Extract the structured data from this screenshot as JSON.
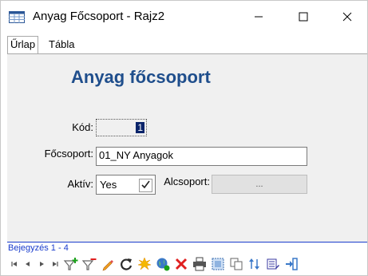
{
  "window": {
    "title": "Anyag Főcsoport - Rajz2",
    "minimize_icon": "minimize-icon",
    "maximize_icon": "maximize-icon",
    "close_icon": "close-icon"
  },
  "tabs": [
    {
      "label": "Űrlap",
      "active": true
    },
    {
      "label": "Tábla",
      "active": false
    }
  ],
  "form": {
    "title": "Anyag főcsoport",
    "kod_label": "Kód:",
    "kod_value": "1",
    "focsoport_label": "Főcsoport:",
    "focsoport_value": "01_NY Anyagok",
    "aktiv_label": "Aktív:",
    "aktiv_value": "Yes",
    "aktiv_checked": true,
    "alcsoport_label": "Alcsoport:",
    "alcsoport_button_label": "..."
  },
  "status": {
    "record_text": "Bejegyzés 1 - 4"
  },
  "navigation": {
    "icons": [
      "first-record-icon",
      "previous-record-icon",
      "next-record-icon",
      "last-record-icon",
      "add-filter-icon",
      "remove-filter-icon",
      "edit-pencil-icon",
      "refresh-icon",
      "new-record-icon",
      "web-export-icon",
      "delete-icon",
      "print-icon",
      "select-icon",
      "copy-icon",
      "sort-icon",
      "list-edit-icon",
      "exit-icon"
    ],
    "colors": {
      "accent": "#1f4e8c",
      "status_blue": "#1a3ccc",
      "delete_red": "#e02020",
      "add_green": "#1aa01a"
    }
  }
}
